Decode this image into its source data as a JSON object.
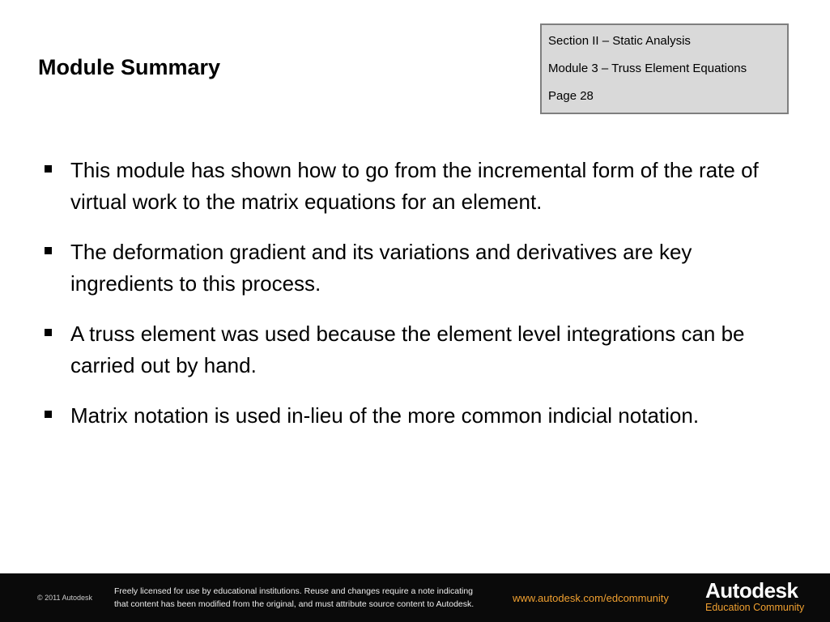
{
  "header": {
    "title": "Module Summary",
    "section": "Section II – Static Analysis",
    "module": "Module 3 – Truss Element Equations",
    "page": "Page 28"
  },
  "bullets": [
    "This module has shown how to go from the incremental form of the rate of virtual work to the matrix equations for an element.",
    "The deformation gradient and its variations and derivatives are key ingredients to this process.",
    "A truss element was used because the element level integrations can be carried out by hand.",
    "Matrix notation is used in-lieu of the more common indicial notation."
  ],
  "footer": {
    "copyright": "© 2011 Autodesk",
    "license_line1": "Freely licensed for use by educational institutions. Reuse and changes require a note indicating",
    "license_line2": "that content has been modified from the original, and must attribute source content to Autodesk.",
    "url": "www.autodesk.com/edcommunity",
    "logo": "Autodesk",
    "logo_sub": "Education Community",
    "accent_color": "#f0a030"
  }
}
